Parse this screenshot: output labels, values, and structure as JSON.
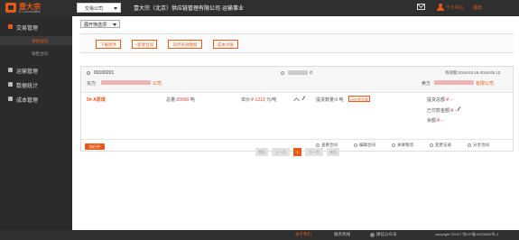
{
  "header": {
    "logo_cn": "壹大宗",
    "logo_en": "E-Commodities",
    "company_select": "交易公司",
    "title": "壹大宗（北京）供应链管理有限公司·运输事业",
    "user_center": "个人中心",
    "logout": "退出"
  },
  "sidebar": {
    "items": [
      {
        "label": "交易管理",
        "icon": "trade-icon"
      },
      {
        "label": "运输管理",
        "icon": "transport-icon"
      },
      {
        "label": "数据统计",
        "icon": "stats-icon"
      },
      {
        "label": "成本管理",
        "icon": "cost-icon"
      }
    ],
    "subitems": [
      "采购合同",
      "销售合同"
    ]
  },
  "toolbar": {
    "filter_label": "展开筛选项",
    "actions": [
      "下载附件",
      "+新建合同",
      "同步有效数据",
      "成本对账"
    ]
  },
  "contract": {
    "number": "00100201",
    "location_suffix": "d",
    "validity": "有效期:2018.04.16-2018.05.12",
    "buyer_label": "买方:",
    "buyer_suffix": "公司",
    "seller_label": "卖方",
    "seller_suffix": "有限公司",
    "product": "5#-A原煤",
    "total_label": "总量:",
    "total_value": "20000",
    "total_unit": "吨",
    "price_label": "单价:",
    "price_value": "¥ 1213",
    "price_unit": "元/吨",
    "pickup_qty_label": "提货数量:",
    "pickup_qty_value": "0 吨",
    "pickup_tag": "历史提货量",
    "pickup_amount_label": "提货总额:",
    "pickup_amount_value": "¥ --",
    "paid_label": "已付款金额:",
    "paid_value": "¥ --",
    "balance_label": "余额:",
    "balance_value": "¥ --",
    "status": "执行中",
    "ops": [
      "查看合同",
      "编辑合同",
      "关联物流",
      "变更记录",
      "分享合同"
    ]
  },
  "pager": {
    "first": "首页",
    "prev": "上一页",
    "current": "1",
    "next": "下一页",
    "last": "末页"
  },
  "footer": {
    "items": [
      "关于我们",
      "服务热线",
      "微信公众号"
    ],
    "copyright": "copyright ©2017 京ICP备14029652号-2"
  },
  "colors": {
    "brand": "#e85a1a",
    "topbar": "#2f2f2f",
    "sidebar": "#2b2b2b"
  }
}
